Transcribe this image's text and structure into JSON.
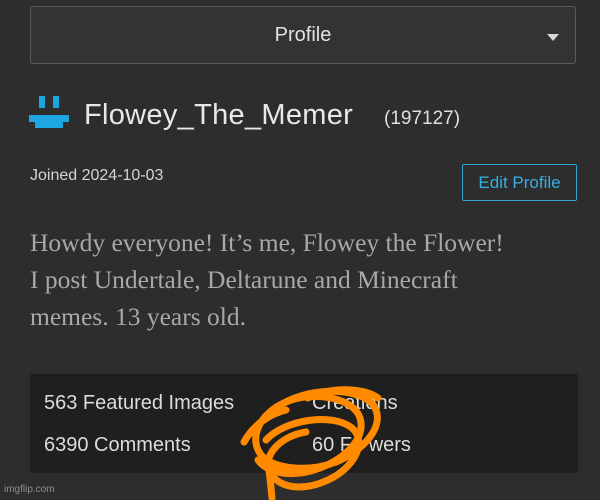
{
  "select": {
    "label": "Profile"
  },
  "profile": {
    "username": "Flowey_The_Memer",
    "points": "(197127)",
    "joined": "Joined 2024-10-03",
    "edit_label": "Edit Profile",
    "bio_lines": [
      "Howdy everyone! It’s me, Flowey the Flower!",
      "I post Undertale, Deltarune and Minecraft",
      "memes. 13 years old."
    ]
  },
  "stats": {
    "featured": "563 Featured Images",
    "creations": "Creations",
    "comments": "6390 Comments",
    "followers": "60 Fo     wers"
  },
  "watermark": "imgflip.com",
  "colors": {
    "background": "#2d2d2d",
    "accent": "#34b1e4",
    "avatar": "#1ea6e0",
    "scribble": "#ff8a00",
    "stats_panel": "#1f1f1f"
  }
}
